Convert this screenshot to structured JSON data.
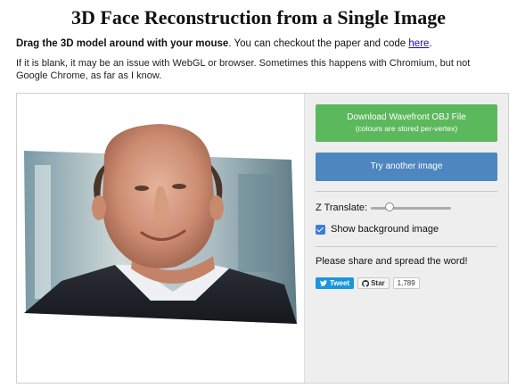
{
  "page": {
    "title": "3D Face Reconstruction from a Single Image"
  },
  "intro": {
    "bold": "Drag the 3D model around with your mouse",
    "rest": ". You can checkout the paper and code ",
    "link": "here",
    "end": "."
  },
  "note": "If it is blank, it may be an issue with WebGL or browser. Sometimes this happens with Chromium, but not Google Chrome, as far as I know.",
  "viewer": {
    "image_description_icon": "reconstructed-face-image"
  },
  "panel": {
    "download_label": "Download Wavefront OBJ File",
    "download_sub": "(colours are stored per-vertex)",
    "try_label": "Try another image",
    "z_translate_label": "Z Translate:",
    "z_translate_value": 0.2,
    "show_bg_label": "Show background image",
    "show_bg_checked": true,
    "share_text": "Please share and spread the word!",
    "tweet_label": "Tweet",
    "star_label": "Star",
    "star_count": "1,789"
  },
  "colors": {
    "download": "#5cb85c",
    "try": "#4e86c0",
    "panel_bg": "#eeeeee",
    "tweet": "#1b95e0"
  }
}
